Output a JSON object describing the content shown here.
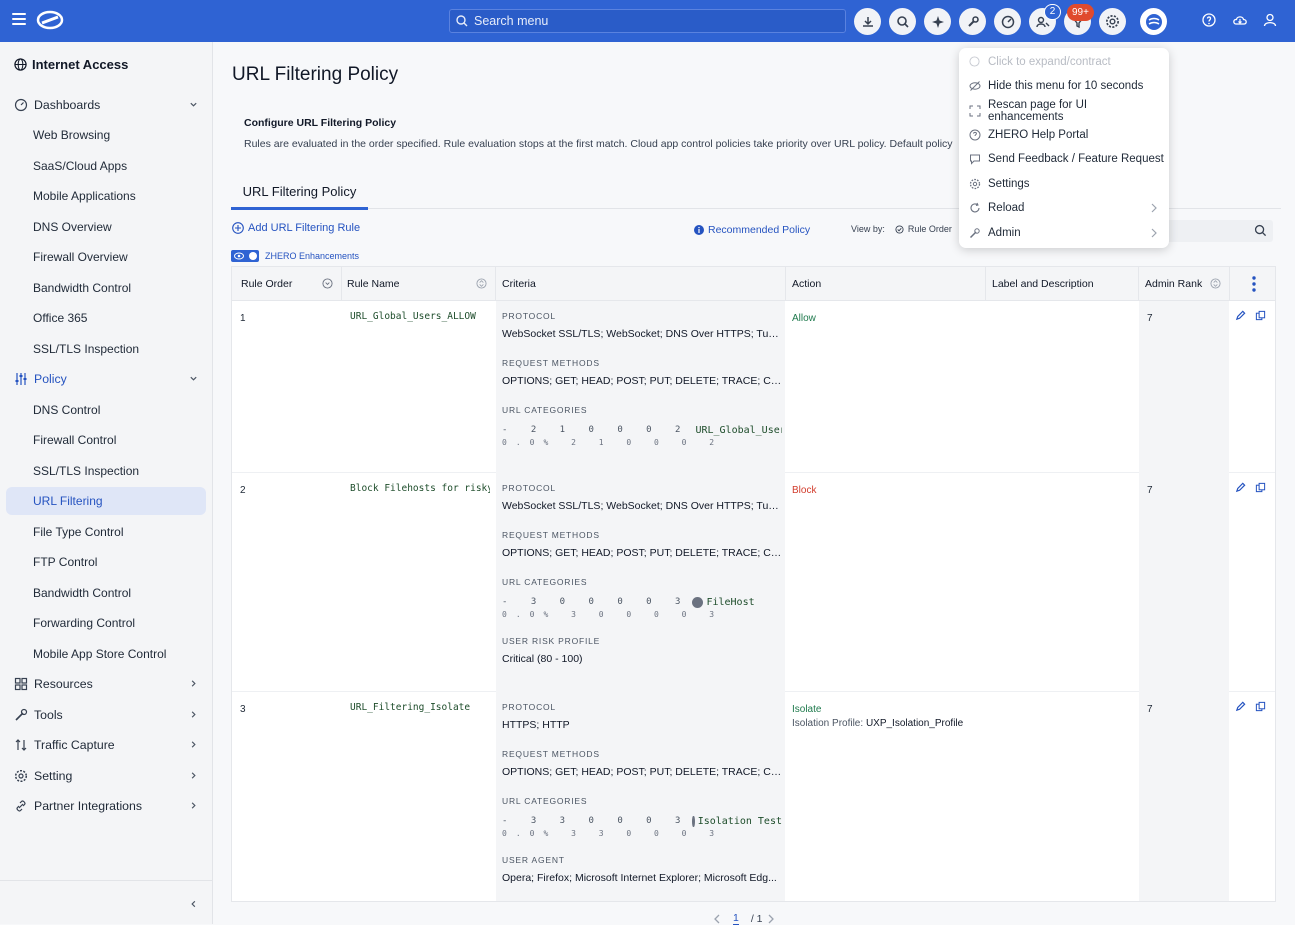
{
  "topbar": {
    "search_placeholder": "Search menu",
    "badge_users": "2",
    "badge_notifications": "99+",
    "icons": [
      "download-icon",
      "search-icon",
      "sparkle-icon",
      "wrench-icon",
      "gauge-icon",
      "users-icon",
      "funnel-icon",
      "gear-icon",
      "zhero-icon",
      "help-icon",
      "cloud-icon",
      "user-icon"
    ]
  },
  "sidebar": {
    "title": "Internet Access",
    "items": [
      {
        "label": "Dashboards"
      },
      {
        "label": "Web Browsing"
      },
      {
        "label": "SaaS/Cloud Apps"
      },
      {
        "label": "Mobile Applications"
      },
      {
        "label": "DNS Overview"
      },
      {
        "label": "Firewall Overview"
      },
      {
        "label": "Bandwidth Control"
      },
      {
        "label": "Office 365"
      },
      {
        "label": "SSL/TLS Inspection"
      },
      {
        "label": "Policy"
      },
      {
        "label": "DNS Control"
      },
      {
        "label": "Firewall Control"
      },
      {
        "label": "SSL/TLS Inspection"
      },
      {
        "label": "URL Filtering"
      },
      {
        "label": "File Type Control"
      },
      {
        "label": "FTP Control"
      },
      {
        "label": "Bandwidth Control"
      },
      {
        "label": "Forwarding Control"
      },
      {
        "label": "Mobile App Store Control"
      },
      {
        "label": "Resources"
      },
      {
        "label": "Tools"
      },
      {
        "label": "Traffic Capture"
      },
      {
        "label": "Setting"
      },
      {
        "label": "Partner Integrations"
      }
    ]
  },
  "main": {
    "title": "URL Filtering Policy",
    "config_title": "Configure URL Filtering Policy",
    "config_desc": "Rules are evaluated in the order specified. Rule evaluation stops at the first match. Cloud app control policies take priority over URL policy. Default policy",
    "tab": "URL Filtering Policy",
    "add_rule": "Add URL Filtering Rule",
    "recommended": "Recommended Policy",
    "view_by_label": "View by:",
    "view_by_value": "Rule Order",
    "view_by_extra": "R",
    "zhero_toggle": "ZHERO Enhancements"
  },
  "table": {
    "headers": [
      "Rule Order",
      "Rule Name",
      "Criteria",
      "Action",
      "Label and Description",
      "Admin Rank"
    ],
    "rows": [
      {
        "order": "1",
        "name": "URL_Global_Users_ALLOW",
        "protocol_label": "PROTOCOL",
        "protocol": "WebSocket SSL/TLS; WebSocket; DNS Over HTTPS; Tun...",
        "methods_label": "REQUEST METHODS",
        "methods": "OPTIONS; GET; HEAD; POST; PUT; DELETE; TRACE; CON...",
        "cat_label": "URL CATEGORIES",
        "cat_dots": "- 2 1 0 0 0 2",
        "cat_name": "URL_Global_Users_Cate",
        "cat_dots2": "0.0% 2 1 0 0 0 2",
        "action": "Allow",
        "action_color": "#1f7a4d",
        "rank": "7"
      },
      {
        "order": "2",
        "name": "Block Filehosts for risky u",
        "protocol_label": "PROTOCOL",
        "protocol": "WebSocket SSL/TLS; WebSocket; DNS Over HTTPS; Tun...",
        "methods_label": "REQUEST METHODS",
        "methods": "OPTIONS; GET; HEAD; POST; PUT; DELETE; TRACE; CON...",
        "cat_label": "URL CATEGORIES",
        "cat_dots": "- 3 0 0 0 0 3",
        "cat_name": "FileHost",
        "cat_dots2": "0.0% 3 0 0 0 0 3",
        "extra_label": "USER RISK PROFILE",
        "extra_value": "Critical (80 - 100)",
        "action": "Block",
        "action_color": "#d23c2c",
        "rank": "7"
      },
      {
        "order": "3",
        "name": "URL_Filtering_Isolate",
        "protocol_label": "PROTOCOL",
        "protocol": "HTTPS; HTTP",
        "methods_label": "REQUEST METHODS",
        "methods": "OPTIONS; GET; HEAD; POST; PUT; DELETE; TRACE; CON...",
        "cat_label": "URL CATEGORIES",
        "cat_dots": "- 3 3 0 0 0 3",
        "cat_name": "Isolation Test",
        "cat_dots2": "0.0% 3 3 0 0 0 3",
        "extra_label": "USER AGENT",
        "extra_value": "Opera; Firefox; Microsoft Internet Explorer; Microsoft Edg...",
        "action": "Isolate",
        "action_color": "#1f7a4d",
        "isolation_label": "Isolation Profile:",
        "isolation_value": "UXP_Isolation_Profile",
        "rank": "7"
      }
    ]
  },
  "pager": {
    "current": "1",
    "total": "/ 1"
  },
  "popup": {
    "items": [
      {
        "label": "Click to expand/contract"
      },
      {
        "label": "Hide this menu for 10 seconds"
      },
      {
        "label": "Rescan page for UI enhancements"
      },
      {
        "label": "ZHERO Help Portal"
      },
      {
        "label": "Send Feedback / Feature Request"
      },
      {
        "label": "Settings"
      },
      {
        "label": "Reload"
      },
      {
        "label": "Admin"
      }
    ]
  },
  "colors": {
    "brand": "#2f63d3",
    "allow": "#1f7a4d",
    "block": "#d23c2c",
    "badge": "#e04a2d"
  }
}
